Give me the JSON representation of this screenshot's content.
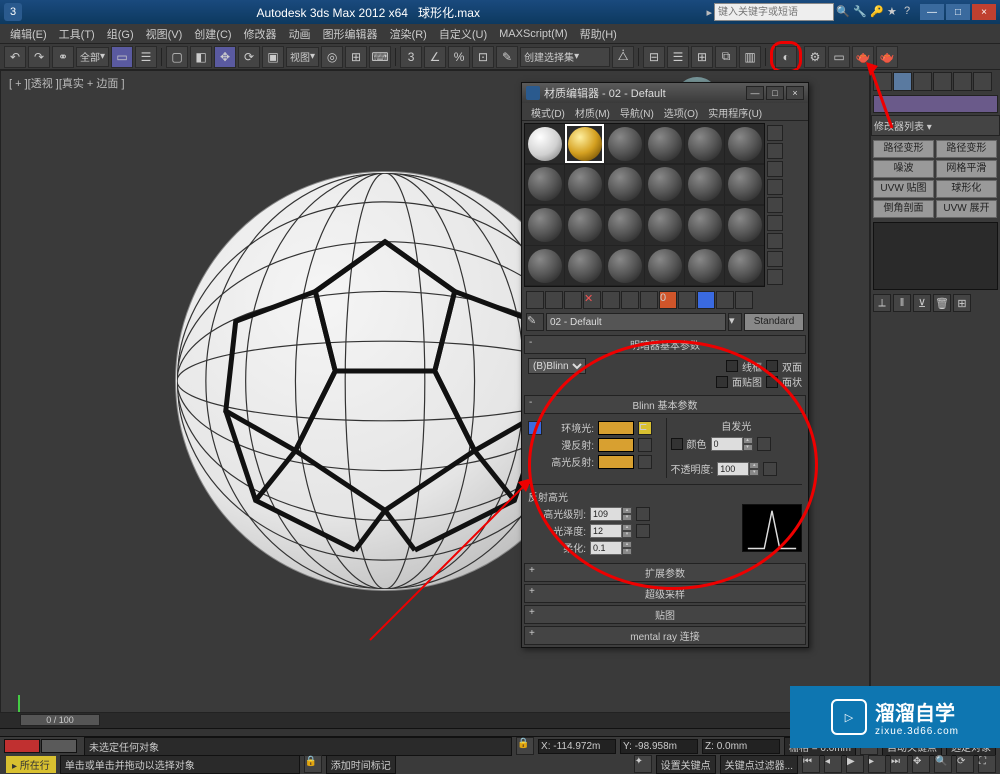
{
  "title": {
    "app": "Autodesk 3ds Max  2012 x64",
    "file": "球形化.max",
    "search_placeholder": "键入关键字或短语"
  },
  "win_controls": {
    "min": "—",
    "max": "□",
    "close": "×"
  },
  "menus": [
    "编辑(E)",
    "工具(T)",
    "组(G)",
    "视图(V)",
    "创建(C)",
    "修改器",
    "动画",
    "图形编辑器",
    "渲染(R)",
    "自定义(U)",
    "MAXScript(M)",
    "帮助(H)"
  ],
  "toolbar": {
    "all_dropdown": "全部",
    "view_dropdown": "视图",
    "create_select": "创建选择集"
  },
  "viewport": {
    "label": "[ + ][透视 ][真实 + 边面 ]"
  },
  "cmd_panel": {
    "modifier_list": "修改器列表",
    "mods": [
      "路径变形",
      "噪波",
      "UVW 贴图",
      "倒角剖面"
    ],
    "mods2": [
      "路径变形",
      "网格平滑",
      "球形化",
      "UVW 展开"
    ]
  },
  "material_editor": {
    "title": "材质编辑器 - 02 - Default",
    "menus": [
      "模式(D)",
      "材质(M)",
      "导航(N)",
      "选项(O)",
      "实用程序(U)"
    ],
    "name": "02 - Default",
    "type": "Standard",
    "rollout_shader_title": "明暗器基本参数",
    "shader": "(B)Blinn",
    "cb_wire": "线框",
    "cb_2side": "双面",
    "cb_facemap": "面贴图",
    "cb_faceted": "面状",
    "rollout_blinn_title": "Blinn 基本参数",
    "labels": {
      "ambient": "环境光:",
      "diffuse": "漫反射:",
      "specular": "高光反射:",
      "selfillum_title": "自发光",
      "selfillum_color": "颜色",
      "selfillum_val": "0",
      "opacity": "不透明度:",
      "opacity_val": "100",
      "spec_section": "反射高光",
      "spec_level": "高光级别:",
      "spec_level_val": "109",
      "gloss": "光泽度:",
      "gloss_val": "12",
      "soften": "柔化:",
      "soften_val": "0.1"
    },
    "rollouts_collapsed": [
      "扩展参数",
      "超级采样",
      "贴图",
      "mental ray 连接"
    ]
  },
  "status": {
    "none_selected": "未选定任何对象",
    "hint": "单击或单击并拖动以选择对象",
    "add_time_tag": "添加时间标记",
    "x": "-114.972m",
    "y": "-98.958m",
    "z": "0.0mm",
    "grid": "栅格 = 0.0mm",
    "auto_key": "自动关键点",
    "sel_lock": "选定对象",
    "set_key": "设置关键点",
    "key_filter": "关键点过滤器...",
    "now_tag": "所在行",
    "time_range": "0 / 100"
  },
  "watermark": {
    "big": "溜溜自学",
    "small": "zixue.3d66.com"
  }
}
